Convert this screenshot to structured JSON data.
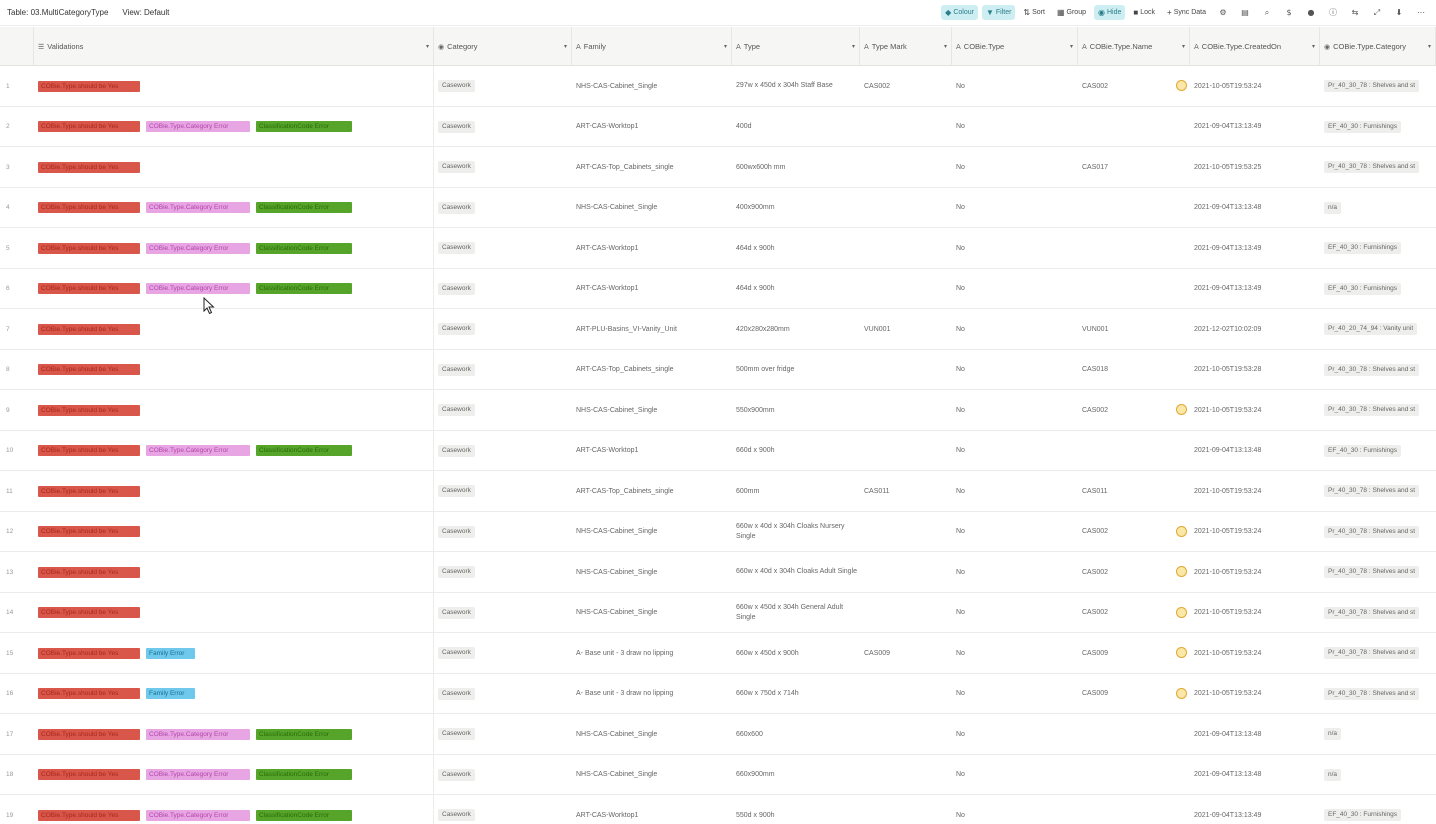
{
  "topbar": {
    "table_label": "Table: 03.MultiCategoryType",
    "view_label": "View: Default",
    "buttons": [
      {
        "label": "Colour",
        "icon": "paint-icon",
        "highlight": true
      },
      {
        "label": "Filter",
        "icon": "filter-icon",
        "highlight": true
      },
      {
        "label": "Sort",
        "icon": "sort-icon",
        "highlight": false
      },
      {
        "label": "Group",
        "icon": "group-icon",
        "highlight": false
      },
      {
        "label": "Hide",
        "icon": "eye-icon",
        "highlight": true
      },
      {
        "label": "Lock",
        "icon": "lock-icon",
        "highlight": false
      },
      {
        "label": "Sync Data",
        "icon": "plus-icon",
        "highlight": false
      }
    ],
    "icons": [
      "settings-icon",
      "layout-icon",
      "search-icon",
      "dollar-icon",
      "user-icon",
      "info-icon",
      "share-icon",
      "expand-icon",
      "download-icon",
      "more-icon"
    ]
  },
  "columns": [
    {
      "label": "Validations",
      "icon": "list-icon"
    },
    {
      "label": "Category",
      "icon": "single-select-icon"
    },
    {
      "label": "Family",
      "icon": "text-icon"
    },
    {
      "label": "Type",
      "icon": "text-icon"
    },
    {
      "label": "Type Mark",
      "icon": "text-icon"
    },
    {
      "label": "COBie.Type",
      "icon": "text-icon"
    },
    {
      "label": "COBie.Type.Name",
      "icon": "text-icon"
    },
    {
      "label": "COBie.Type.CreatedOn",
      "icon": "text-icon"
    },
    {
      "label": "COBie.Type.Category",
      "icon": "single-select-icon"
    }
  ],
  "tag_labels": {
    "red": "COBie.Type.should be Yes",
    "pink": "COBie.Type.Category Error",
    "green": "ClassificationCode Error",
    "blue": "Family Error"
  },
  "rows": [
    {
      "num": "1",
      "tags": [
        "red"
      ],
      "category": "Casework",
      "family": "NHS-CAS-Cabinet_Single",
      "type": "297w x 450d x 304h Staff Base",
      "mark": "CAS002",
      "cobie": "No",
      "name": "CAS002",
      "warn": true,
      "created": "2021-10-05T19:53:24",
      "tcat": "Pr_40_30_78 : Shelves and st"
    },
    {
      "num": "2",
      "tags": [
        "red",
        "pink",
        "green"
      ],
      "category": "Casework",
      "family": "ART-CAS-Worktop1",
      "type": "400d",
      "mark": "",
      "cobie": "No",
      "name": "",
      "warn": false,
      "created": "2021-09-04T13:13:49",
      "tcat": "EF_40_30 : Furnishings"
    },
    {
      "num": "3",
      "tags": [
        "red"
      ],
      "category": "Casework",
      "family": "ART-CAS-Top_Cabinets_single",
      "type": "600wx600h mm",
      "mark": "",
      "cobie": "No",
      "name": "CAS017",
      "warn": false,
      "created": "2021-10-05T19:53:25",
      "tcat": "Pr_40_30_78 : Shelves and st"
    },
    {
      "num": "4",
      "tags": [
        "red",
        "pink",
        "green"
      ],
      "category": "Casework",
      "family": "NHS-CAS-Cabinet_Single",
      "type": "400x900mm",
      "mark": "",
      "cobie": "No",
      "name": "",
      "warn": false,
      "created": "2021-09-04T13:13:48",
      "tcat": "n/a"
    },
    {
      "num": "5",
      "tags": [
        "red",
        "pink",
        "green"
      ],
      "category": "Casework",
      "family": "ART-CAS-Worktop1",
      "type": "464d x 900h",
      "mark": "",
      "cobie": "No",
      "name": "",
      "warn": false,
      "created": "2021-09-04T13:13:49",
      "tcat": "EF_40_30 : Furnishings"
    },
    {
      "num": "6",
      "tags": [
        "red",
        "pink",
        "green"
      ],
      "category": "Casework",
      "family": "ART-CAS-Worktop1",
      "type": "464d x 900h",
      "mark": "",
      "cobie": "No",
      "name": "",
      "warn": false,
      "created": "2021-09-04T13:13:49",
      "tcat": "EF_40_30 : Furnishings"
    },
    {
      "num": "7",
      "tags": [
        "red"
      ],
      "category": "Casework",
      "family": "ART-PLU-Basins_VI-Vanity_Unit",
      "type": "420x280x280mm",
      "mark": "VUN001",
      "cobie": "No",
      "name": "VUN001",
      "warn": false,
      "created": "2021-12-02T10:02:09",
      "tcat": "Pr_40_20_74_94 : Vanity unit"
    },
    {
      "num": "8",
      "tags": [
        "red"
      ],
      "category": "Casework",
      "family": "ART-CAS-Top_Cabinets_single",
      "type": "500mm over fridge",
      "mark": "",
      "cobie": "No",
      "name": "CAS018",
      "warn": false,
      "created": "2021-10-05T19:53:28",
      "tcat": "Pr_40_30_78 : Shelves and st"
    },
    {
      "num": "9",
      "tags": [
        "red"
      ],
      "category": "Casework",
      "family": "NHS-CAS-Cabinet_Single",
      "type": "550x900mm",
      "mark": "",
      "cobie": "No",
      "name": "CAS002",
      "warn": true,
      "created": "2021-10-05T19:53:24",
      "tcat": "Pr_40_30_78 : Shelves and st"
    },
    {
      "num": "10",
      "tags": [
        "red",
        "pink",
        "green"
      ],
      "category": "Casework",
      "family": "ART-CAS-Worktop1",
      "type": "660d x 900h",
      "mark": "",
      "cobie": "No",
      "name": "",
      "warn": false,
      "created": "2021-09-04T13:13:48",
      "tcat": "EF_40_30 : Furnishings"
    },
    {
      "num": "11",
      "tags": [
        "red"
      ],
      "category": "Casework",
      "family": "ART-CAS-Top_Cabinets_single",
      "type": "600mm",
      "mark": "CAS011",
      "cobie": "No",
      "name": "CAS011",
      "warn": false,
      "created": "2021-10-05T19:53:24",
      "tcat": "Pr_40_30_78 : Shelves and st"
    },
    {
      "num": "12",
      "tags": [
        "red"
      ],
      "category": "Casework",
      "family": "NHS-CAS-Cabinet_Single",
      "type": "660w x 40d x 304h Cloaks Nursery Single",
      "mark": "",
      "cobie": "No",
      "name": "CAS002",
      "warn": true,
      "created": "2021-10-05T19:53:24",
      "tcat": "Pr_40_30_78 : Shelves and st"
    },
    {
      "num": "13",
      "tags": [
        "red"
      ],
      "category": "Casework",
      "family": "NHS-CAS-Cabinet_Single",
      "type": "660w x 40d x 304h Cloaks Adult Single",
      "mark": "",
      "cobie": "No",
      "name": "CAS002",
      "warn": true,
      "created": "2021-10-05T19:53:24",
      "tcat": "Pr_40_30_78 : Shelves and st"
    },
    {
      "num": "14",
      "tags": [
        "red"
      ],
      "category": "Casework",
      "family": "NHS-CAS-Cabinet_Single",
      "type": "660w x 450d x 304h General Adult Single",
      "mark": "",
      "cobie": "No",
      "name": "CAS002",
      "warn": true,
      "created": "2021-10-05T19:53:24",
      "tcat": "Pr_40_30_78 : Shelves and st"
    },
    {
      "num": "15",
      "tags": [
        "red",
        "blue"
      ],
      "category": "Casework",
      "family": "A- Base unit - 3 draw no lipping",
      "type": "660w x 450d x 900h",
      "mark": "CAS009",
      "cobie": "No",
      "name": "CAS009",
      "warn": true,
      "created": "2021-10-05T19:53:24",
      "tcat": "Pr_40_30_78 : Shelves and st"
    },
    {
      "num": "16",
      "tags": [
        "red",
        "blue"
      ],
      "category": "Casework",
      "family": "A- Base unit - 3 draw no lipping",
      "type": "660w x 750d x 714h",
      "mark": "",
      "cobie": "No",
      "name": "CAS009",
      "warn": true,
      "created": "2021-10-05T19:53:24",
      "tcat": "Pr_40_30_78 : Shelves and st"
    },
    {
      "num": "17",
      "tags": [
        "red",
        "pink",
        "green"
      ],
      "category": "Casework",
      "family": "NHS-CAS-Cabinet_Single",
      "type": "660x600",
      "mark": "",
      "cobie": "No",
      "name": "",
      "warn": false,
      "created": "2021-09-04T13:13:48",
      "tcat": "n/a"
    },
    {
      "num": "18",
      "tags": [
        "red",
        "pink",
        "green"
      ],
      "category": "Casework",
      "family": "NHS-CAS-Cabinet_Single",
      "type": "660x900mm",
      "mark": "",
      "cobie": "No",
      "name": "",
      "warn": false,
      "created": "2021-09-04T13:13:48",
      "tcat": "n/a"
    },
    {
      "num": "19",
      "tags": [
        "red",
        "pink",
        "green"
      ],
      "category": "Casework",
      "family": "ART-CAS-Worktop1",
      "type": "550d x 900h",
      "mark": "",
      "cobie": "No",
      "name": "",
      "warn": false,
      "created": "2021-09-04T13:13:49",
      "tcat": "EF_40_30 : Furnishings"
    }
  ]
}
